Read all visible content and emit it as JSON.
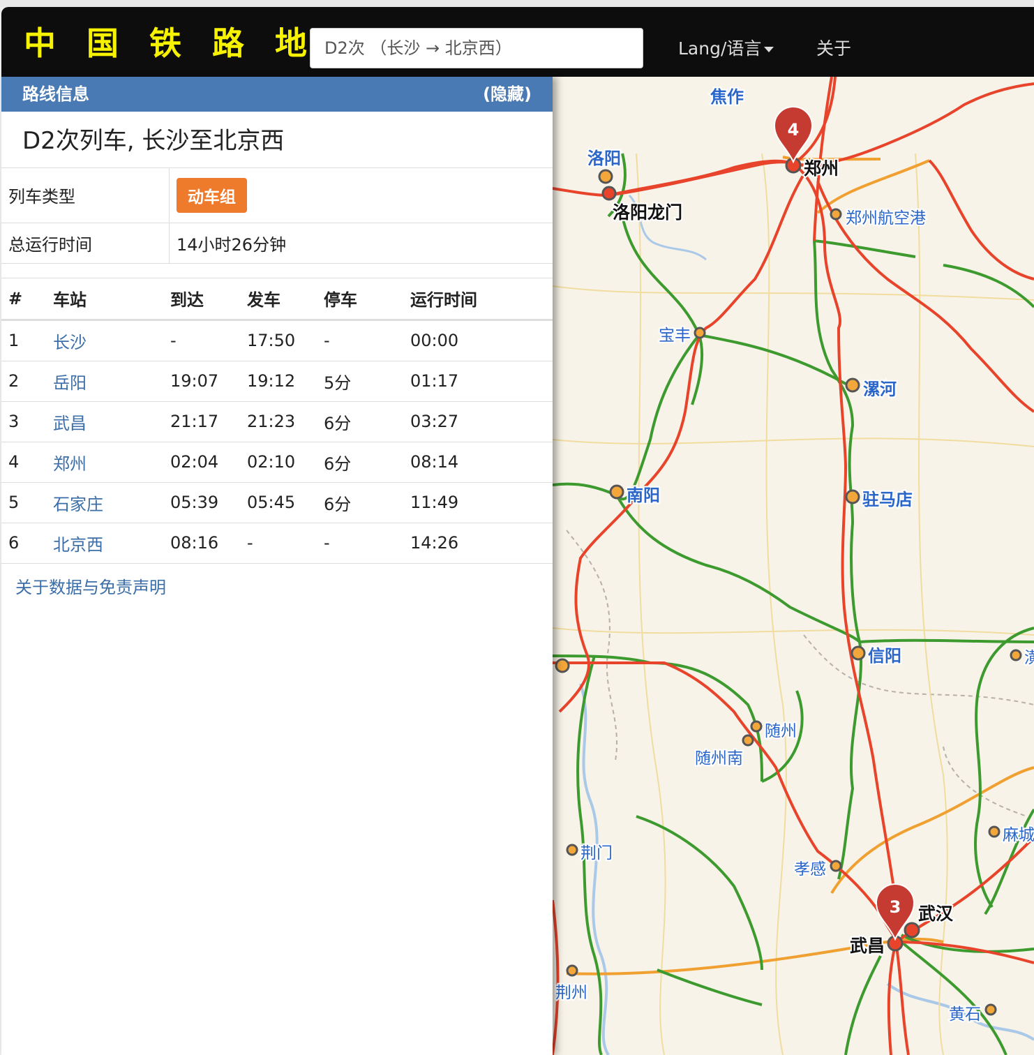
{
  "app": {
    "brand": "中 国 铁 路 地 图"
  },
  "search": {
    "value": "D2次 （长沙 → 北京西）"
  },
  "nav": {
    "lang_label": "Lang/语言",
    "about_label": "关于"
  },
  "panel": {
    "header_title": "路线信息",
    "hide_label": "(隐藏)",
    "route_title": "D2次列车, 长沙至北京西",
    "train_type_label": "列车类型",
    "train_type_value": "动车组",
    "total_time_label": "总运行时间",
    "total_time_value": "14小时26分钟",
    "columns": [
      "#",
      "车站",
      "到达",
      "发车",
      "停车",
      "运行时间"
    ],
    "stops": [
      {
        "no": "1",
        "station": "长沙",
        "arrive": "-",
        "depart": "17:50",
        "stop": "-",
        "elapsed": "00:00"
      },
      {
        "no": "2",
        "station": "岳阳",
        "arrive": "19:07",
        "depart": "19:12",
        "stop": "5分",
        "elapsed": "01:17"
      },
      {
        "no": "3",
        "station": "武昌",
        "arrive": "21:17",
        "depart": "21:23",
        "stop": "6分",
        "elapsed": "03:27"
      },
      {
        "no": "4",
        "station": "郑州",
        "arrive": "02:04",
        "depart": "02:10",
        "stop": "6分",
        "elapsed": "08:14"
      },
      {
        "no": "5",
        "station": "石家庄",
        "arrive": "05:39",
        "depart": "05:45",
        "stop": "6分",
        "elapsed": "11:49"
      },
      {
        "no": "6",
        "station": "北京西",
        "arrive": "08:16",
        "depart": "-",
        "stop": "-",
        "elapsed": "14:26"
      }
    ],
    "disclaimer": "关于数据与免责声明"
  },
  "map": {
    "labels": {
      "jiaozuo": "焦作",
      "luoyang": "洛阳",
      "zhengzhou": "郑州",
      "luoyang_longmen": "洛阳龙门",
      "zhengzhou_airport": "郑州航空港",
      "baofeng": "宝丰",
      "luohe": "漯河",
      "nanyang": "南阳",
      "zhumadian": "驻马店",
      "xinyang": "信阳",
      "suizhou": "随州",
      "suizhou_nan": "随州南",
      "jingmen": "荆门",
      "xiaogan": "孝感",
      "macheng": "麻城",
      "wuhan": "武汉",
      "wuchang": "武昌",
      "jingzhou": "荆州",
      "huangshi": "黄石",
      "huang_edge": "潢"
    },
    "markers": {
      "zhengzhou": "4",
      "wuchang": "3"
    },
    "colors": {
      "high_speed": "#e8432b",
      "conventional": "#3d9a2e",
      "other_rail": "#f0a030",
      "label_blue": "#2a66c9",
      "marker": "#c53b32"
    }
  }
}
